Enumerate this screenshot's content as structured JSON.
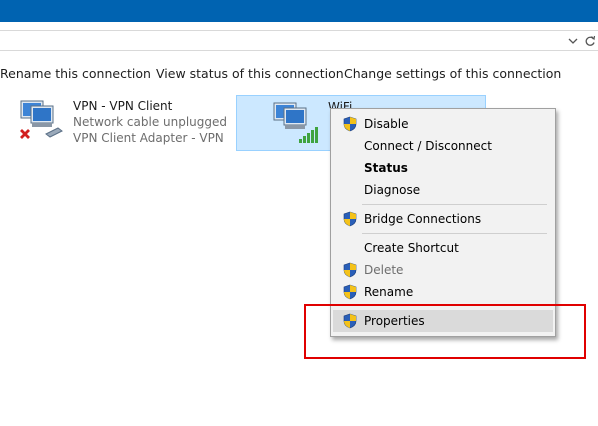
{
  "toolbar": {
    "rename": "Rename this connection",
    "view_status": "View status of this connection",
    "change_settings": "Change settings of this connection"
  },
  "address": {
    "dropdown_icon": "chevron-down-icon",
    "refresh_icon": "refresh-icon"
  },
  "vpn": {
    "name": "VPN - VPN Client",
    "status": "Network cable unplugged",
    "adapter": "VPN Client Adapter - VPN"
  },
  "wifi": {
    "name": "WiFi"
  },
  "context_menu": {
    "items": [
      {
        "label": "Disable",
        "shield": true
      },
      {
        "label": "Connect / Disconnect",
        "shield": false
      },
      {
        "label": "Status",
        "shield": false,
        "bold": true
      },
      {
        "label": "Diagnose",
        "shield": false
      },
      {
        "label": "Bridge Connections",
        "shield": true
      },
      {
        "label": "Create Shortcut",
        "shield": false
      },
      {
        "label": "Delete",
        "shield": true,
        "disabled": true
      },
      {
        "label": "Rename",
        "shield": true
      },
      {
        "label": "Properties",
        "shield": true,
        "hovered": true
      }
    ]
  },
  "colors": {
    "titlebar": "#0063b1",
    "selection": "#cce8ff",
    "highlight_box": "#e00000"
  }
}
